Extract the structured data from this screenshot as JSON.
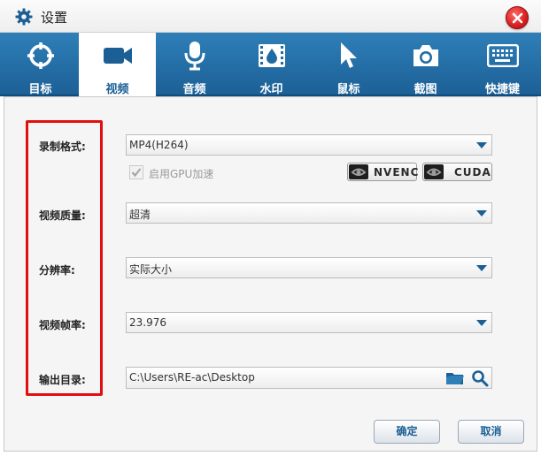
{
  "window": {
    "title": "设置",
    "icons": {
      "title": "gear-icon",
      "close": "close-icon"
    }
  },
  "tabs": [
    {
      "label": "目标",
      "icon": "crosshair-icon",
      "active": false
    },
    {
      "label": "视频",
      "icon": "video-camera-icon",
      "active": true
    },
    {
      "label": "音频",
      "icon": "microphone-icon",
      "active": false
    },
    {
      "label": "水印",
      "icon": "film-watermark-icon",
      "active": false
    },
    {
      "label": "鼠标",
      "icon": "mouse-cursor-icon",
      "active": false
    },
    {
      "label": "截图",
      "icon": "camera-icon",
      "active": false
    },
    {
      "label": "快捷键",
      "icon": "keyboard-icon",
      "active": false
    }
  ],
  "settings": {
    "record_format": {
      "label": "录制格式:",
      "value": "MP4(H264)"
    },
    "gpu": {
      "label": "启用GPU加速",
      "checked": true,
      "badges": [
        "NVENC",
        "CUDA"
      ]
    },
    "quality": {
      "label": "视频质量:",
      "value": "超清"
    },
    "resolution": {
      "label": "分辨率:",
      "value": "实际大小"
    },
    "framerate": {
      "label": "视频帧率:",
      "value": "23.976"
    },
    "output_dir": {
      "label": "输出目录:",
      "value": "C:\\Users\\RE-ac\\Desktop"
    }
  },
  "buttons": {
    "ok": "确定",
    "cancel": "取消"
  },
  "colors": {
    "tab_bar": "#1b5f95",
    "accent": "#1b5f95",
    "highlight_box": "#e01010",
    "close_button": "#d81e1e"
  }
}
